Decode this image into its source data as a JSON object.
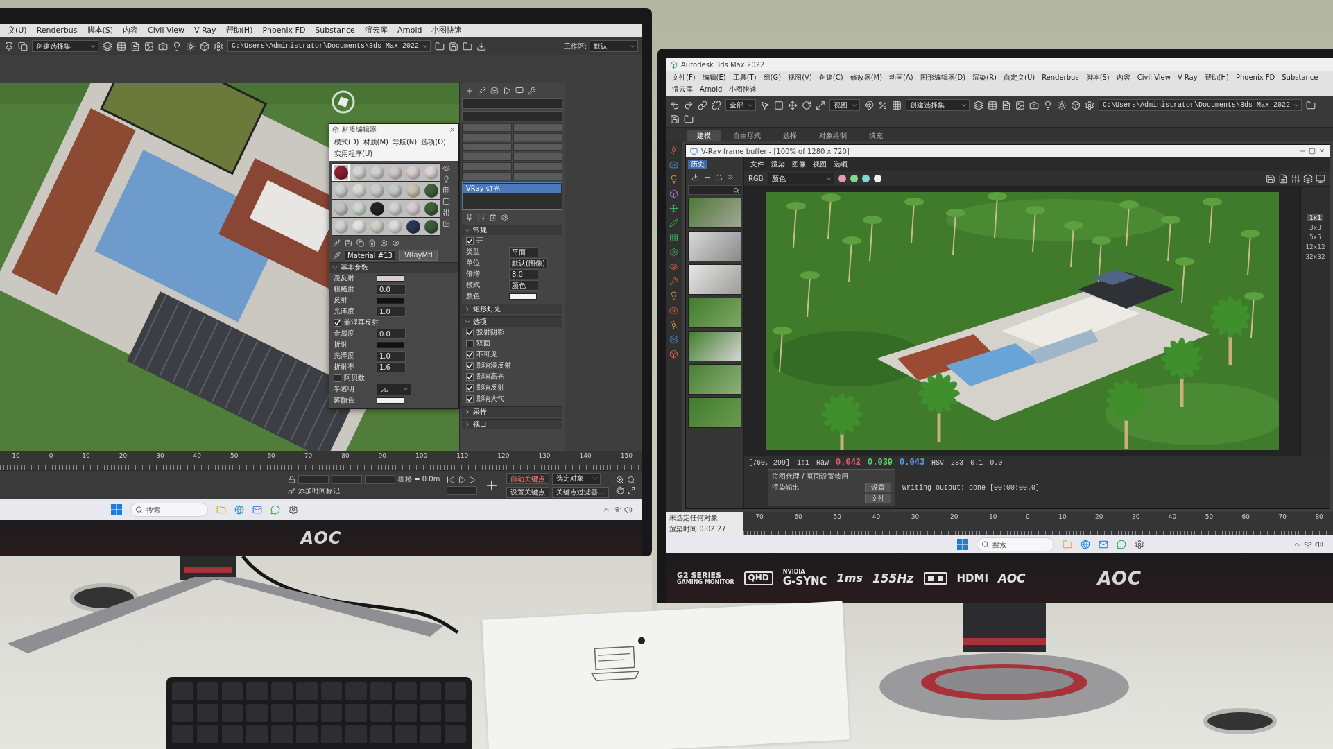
{
  "left_monitor": {
    "menu": [
      "义(U)",
      "Renderbus",
      "脚本(S)",
      "内容",
      "Civil View",
      "V-Ray",
      "帮助(H)",
      "Phoenix FD",
      "Substance",
      "渲云库",
      "Arnold",
      "小图快速"
    ],
    "toolbar": {
      "selection_set": "创建选择集",
      "path": "C:\\Users\\Administrator\\Documents\\3ds Max 2022",
      "workspace_label": "工作区:",
      "workspace": "默认"
    },
    "material_editor": {
      "title": "材质编辑器",
      "menu": [
        "模式(D)",
        "材质(M)",
        "导航(N)",
        "选项(O)",
        "实用程序(U)"
      ],
      "spheres": [
        {
          "color": "#8c1f30",
          "selected": true
        },
        {
          "color": "#d6d6d3",
          "selected": false
        },
        {
          "color": "#d0d0cc",
          "selected": false
        },
        {
          "color": "#cdc8c6",
          "selected": false
        },
        {
          "color": "#d6cfcc",
          "selected": false
        },
        {
          "color": "#ddd2d2",
          "selected": false
        },
        {
          "color": "#ccd0ce",
          "selected": false
        },
        {
          "color": "#d6dcd5",
          "selected": false
        },
        {
          "color": "#c8cecc",
          "selected": false
        },
        {
          "color": "#c4cac5",
          "selected": false
        },
        {
          "color": "#c8c3b2",
          "selected": false
        },
        {
          "color": "#3f5e3a",
          "selected": false
        },
        {
          "color": "#bec5c3",
          "selected": false
        },
        {
          "color": "#cfd6d0",
          "selected": false
        },
        {
          "color": "#232323",
          "selected": false
        },
        {
          "color": "#d4d1d3",
          "selected": false
        },
        {
          "color": "#d7ccd0",
          "selected": false
        },
        {
          "color": "#3e5f38",
          "selected": false
        },
        {
          "color": "#d2d3d1",
          "selected": false
        },
        {
          "color": "#e1e1df",
          "selected": false
        },
        {
          "color": "#cecfc7",
          "selected": false
        },
        {
          "color": "#dcdbd9",
          "selected": false
        },
        {
          "color": "#2c3554",
          "selected": false
        },
        {
          "color": "#3c5c38",
          "selected": false
        }
      ],
      "material_name": "Material #13",
      "material_type": "VRayMtl",
      "rollout": "基本参数",
      "params": [
        {
          "kind": "color",
          "label": "漫反射",
          "color": "#dccdd2"
        },
        {
          "kind": "number",
          "label": "粗糙度",
          "value": "0.0"
        },
        {
          "kind": "color",
          "label": "反射",
          "color": "#121212"
        },
        {
          "kind": "number",
          "label": "光泽度",
          "value": "1.0"
        },
        {
          "kind": "check",
          "label": "菲涅耳反射",
          "checked": true
        },
        {
          "kind": "number",
          "label": "金属度",
          "value": "0.0"
        },
        {
          "kind": "color",
          "label": "折射",
          "color": "#101010"
        },
        {
          "kind": "number",
          "label": "光泽度",
          "value": "1.0"
        },
        {
          "kind": "number",
          "label": "折射率",
          "value": "1.6"
        },
        {
          "kind": "check",
          "label": "阿贝数",
          "checked": false
        },
        {
          "kind": "dropdown",
          "label": "半透明",
          "value": "无"
        },
        {
          "kind": "color",
          "label": "雾颜色",
          "color": "#f2f2f2"
        }
      ]
    },
    "command_panel": {
      "objects": [
        {
          "label": "VRay 灯光",
          "selected": true
        }
      ],
      "rollouts": [
        {
          "title": "常规",
          "expanded": true,
          "rows": [
            {
              "kind": "check",
              "label": "开",
              "checked": true
            },
            {
              "kind": "field",
              "label": "类型",
              "value": "平面"
            },
            {
              "kind": "field",
              "label": "单位",
              "value": "默认(图像)"
            },
            {
              "kind": "field",
              "label": "倍增",
              "value": "8.0"
            },
            {
              "kind": "field",
              "label": "模式",
              "value": "颜色"
            },
            {
              "kind": "color",
              "label": "颜色",
              "color": "#f4f4f4"
            }
          ]
        },
        {
          "title": "矩形灯光",
          "expanded": false
        },
        {
          "title": "选项",
          "expanded": true,
          "rows": [
            {
              "kind": "check",
              "label": "投射阴影",
              "checked": true
            },
            {
              "kind": "check",
              "label": "双面",
              "checked": false
            },
            {
              "kind": "check",
              "label": "不可见",
              "checked": true
            },
            {
              "kind": "check",
              "label": "影响漫反射",
              "checked": true
            },
            {
              "kind": "check",
              "label": "影响高光",
              "checked": true
            },
            {
              "kind": "check",
              "label": "影响反射",
              "checked": true
            },
            {
              "kind": "check",
              "label": "影响大气",
              "checked": true
            }
          ]
        },
        {
          "title": "采样",
          "expanded": false
        },
        {
          "title": "视口",
          "expanded": false
        }
      ]
    },
    "timeline": {
      "ticks": [
        "-10",
        "0",
        "10",
        "20",
        "30",
        "40",
        "50",
        "60",
        "70",
        "80",
        "90",
        "100",
        "110",
        "120",
        "130",
        "140",
        "150"
      ]
    },
    "status": {
      "grid": "栅格 = 0.0m",
      "time_tag": "添加时间标记",
      "auto_key": "自动关键点",
      "key_mode": "选定对象",
      "set_key": "设置关键点",
      "key_filters": "关键点过滤器..."
    },
    "taskbar": {
      "placeholder": "搜索"
    },
    "logo": "AOC"
  },
  "right_monitor": {
    "title": "Autodesk 3ds Max 2022",
    "menu": [
      "文件(F)",
      "编辑(E)",
      "工具(T)",
      "组(G)",
      "视图(V)",
      "创建(C)",
      "修改器(M)",
      "动画(A)",
      "图形编辑器(D)",
      "渲染(R)",
      "自定义(U)",
      "Renderbus",
      "脚本(S)",
      "内容",
      "Civil View",
      "V-Ray",
      "帮助(H)",
      "Phoenix FD",
      "Substance",
      "渲云库",
      "Arnold",
      "小图快速"
    ],
    "toolbar": {
      "selection_filter": "全部",
      "reference_coord": "视图",
      "selection_set": "创建选择集",
      "path": "C:\\Users\\Administrator\\Documents\\3ds Max 2022"
    },
    "ribbon_tabs": [
      {
        "label": "建模",
        "selected": true
      },
      {
        "label": "自由形式",
        "selected": false
      },
      {
        "label": "选择",
        "selected": false
      },
      {
        "label": "对象绘制",
        "selected": false
      },
      {
        "label": "填充",
        "selected": false
      }
    ],
    "vfb": {
      "title": "V-Ray frame buffer - [100% of 1280 x 720]",
      "history_label": "历史",
      "menu": [
        "文件",
        "渲染",
        "图像",
        "视图",
        "选项"
      ],
      "channel": "RGB",
      "display": "颜色",
      "channel_buttons": [
        {
          "color": "#e59aa6"
        },
        {
          "color": "#86d98a"
        },
        {
          "color": "#86d6cc"
        },
        {
          "color": "#f0f0f0"
        }
      ],
      "readings_before": [
        "[760, 299]",
        "1:1",
        "Raw"
      ],
      "rgb": [
        {
          "value": "0.042",
          "color": "#e0606a"
        },
        {
          "value": "0.039",
          "color": "#5fcf6a"
        },
        {
          "value": "0.043",
          "color": "#5aa0e0"
        }
      ],
      "readings_after": [
        "HSV",
        "233",
        "0.1",
        "0.0"
      ],
      "message": "Writing output: done [00:00:00.0]",
      "sample_sizes": [
        {
          "label": "1x1",
          "selected": true
        },
        {
          "label": "3x3",
          "selected": false
        },
        {
          "label": "5x5",
          "selected": false
        },
        {
          "label": "12x12",
          "selected": false
        },
        {
          "label": "32x32",
          "selected": false
        }
      ]
    },
    "render_popup": {
      "heading": "位图代理 / 页面设置禁用",
      "label": "渲染输出",
      "buttons": [
        "设置",
        "文件"
      ]
    },
    "prompt": {
      "message": "未选定任何对象",
      "render_time": "渲染时间 0:02:27"
    },
    "timeline": {
      "ticks": [
        "-70",
        "-60",
        "-50",
        "-40",
        "-30",
        "-20",
        "-10",
        "0",
        "10",
        "20",
        "30",
        "40",
        "50",
        "60",
        "70",
        "80"
      ]
    },
    "taskbar": {
      "placeholder": "搜索"
    },
    "badges": {
      "series": "G2 SERIES",
      "series_subtitle": "GAMING MONITOR",
      "resolution": "QHD",
      "gpu_brand": "NVIDIA",
      "sync": "G-SYNC",
      "response": "1ms",
      "refresh": "155Hz",
      "port": "HDMI",
      "brand": "AOC"
    },
    "logo": "AOC"
  }
}
